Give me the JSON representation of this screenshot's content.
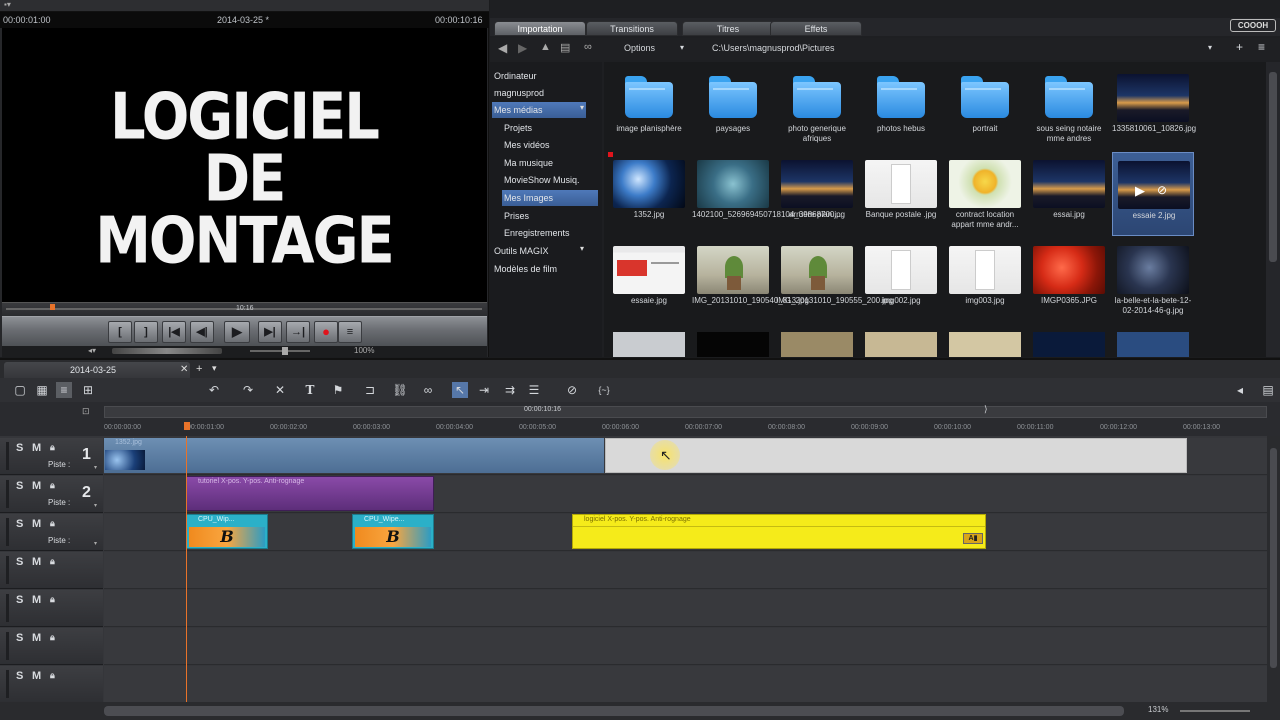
{
  "preview": {
    "time_current": "00:00:01:00",
    "project_name": "2014-03-25 *",
    "time_total": "00:00:10:16",
    "title_line1": "LOGICIEL",
    "title_line2": "DE",
    "title_line3": "MONTAGE",
    "scrub_time": "10:16",
    "zoom": "100%"
  },
  "browser": {
    "tabs": [
      "Importation",
      "Transitions",
      "Titres",
      "Effets"
    ],
    "active_tab": "Importation",
    "brand": "COOOH",
    "options_label": "Options",
    "path": "C:\\Users\\magnusprod\\Pictures",
    "tree": [
      {
        "label": "Ordinateur",
        "indent": false,
        "selected": false
      },
      {
        "label": "magnusprod",
        "indent": false,
        "selected": false
      },
      {
        "label": "Mes médias",
        "indent": false,
        "selected": true
      },
      {
        "label": "Projets",
        "indent": true,
        "selected": false
      },
      {
        "label": "Mes vidéos",
        "indent": true,
        "selected": false
      },
      {
        "label": "Ma musique",
        "indent": true,
        "selected": false
      },
      {
        "label": "MovieShow Musiq.",
        "indent": true,
        "selected": false
      },
      {
        "label": "Mes Images",
        "indent": true,
        "selected": true
      },
      {
        "label": "Prises",
        "indent": true,
        "selected": false
      },
      {
        "label": "Enregistrements",
        "indent": true,
        "selected": false
      },
      {
        "label": "Outils MAGIX",
        "indent": false,
        "selected": false
      },
      {
        "label": "Modèles de film",
        "indent": false,
        "selected": false
      }
    ],
    "files_row1": [
      {
        "label": "image planisphère",
        "kind": "folder"
      },
      {
        "label": "paysages",
        "kind": "folder"
      },
      {
        "label": "photo generique afriques",
        "kind": "folder"
      },
      {
        "label": "photos hebus",
        "kind": "folder"
      },
      {
        "label": "portrait",
        "kind": "folder"
      },
      {
        "label": "sous seing notaire mme andres",
        "kind": "folder"
      },
      {
        "label": "1335810061_10826.jpg",
        "kind": "night-city"
      }
    ],
    "files_row2": [
      {
        "label": "1352.jpg",
        "kind": "blue-space"
      },
      {
        "label": "1402100_526969450718104_39868700...",
        "kind": "underwater"
      },
      {
        "label": "arruere plan.jpg",
        "kind": "night-city"
      },
      {
        "label": "Banque postale .jpg",
        "kind": "doc"
      },
      {
        "label": "contract location appart mme andr...",
        "kind": "flower"
      },
      {
        "label": "essai.jpg",
        "kind": "night-city"
      },
      {
        "label": "essaie 2.jpg",
        "kind": "night-city"
      }
    ],
    "files_row3": [
      {
        "label": "essaie.jpg",
        "kind": "screenshot"
      },
      {
        "label": "IMG_20131010_190540_813.jpg",
        "kind": "plant"
      },
      {
        "label": "IMG_20131010_190555_200.jpg",
        "kind": "plant"
      },
      {
        "label": "img002.jpg",
        "kind": "doc"
      },
      {
        "label": "img003.jpg",
        "kind": "doc"
      },
      {
        "label": "IMGP0365.JPG",
        "kind": "tomatoes"
      },
      {
        "label": "la-belle-et-la-bete-12-02-2014-46-g.jpg",
        "kind": "dark-scene"
      }
    ]
  },
  "timeline": {
    "project_tab": "2014-03-25",
    "ruler_marker": "00:00:10:16",
    "ticks": [
      "00:00:00:00",
      "00:00:01:00",
      "00:00:02:00",
      "00:00:03:00",
      "00:00:04:00",
      "00:00:05:00",
      "00:00:06:00",
      "00:00:07:00",
      "00:00:08:00",
      "00:00:09:00",
      "00:00:10:00",
      "00:00:11:00",
      "00:00:12:00",
      "00:00:13:00"
    ],
    "tracks": [
      {
        "num": "1",
        "piste": "Piste :"
      },
      {
        "num": "2",
        "piste": "Piste :"
      },
      {
        "num": "",
        "piste": "Piste :"
      },
      {
        "num": "",
        "piste": ""
      },
      {
        "num": "",
        "piste": ""
      },
      {
        "num": "",
        "piste": ""
      },
      {
        "num": "",
        "piste": ""
      }
    ],
    "track_s": "S",
    "track_m": "M",
    "clip1_label": "1352.jpg",
    "clip2_label": "tutoriel  X-pos. Y-pos. Anti-rognage",
    "clip3a_label": "CPU_Wip...",
    "clip3b_label": "CPU_Wipe...",
    "clip3c_label": "logiciel  X-pos. Y-pos. Anti-rognage",
    "zoom": "131%",
    "colors": {
      "accent": "#4f79b9",
      "yellow_clip": "#f5eb1a",
      "purple_clip": "#6a3a8a",
      "cyan_clip": "#3aa7c0",
      "playhead": "#e8732a"
    }
  }
}
